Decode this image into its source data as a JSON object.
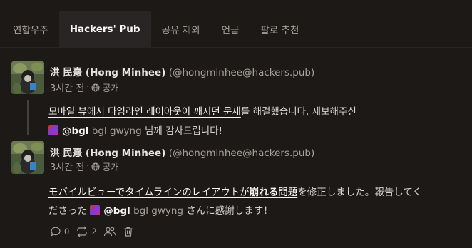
{
  "tabs": [
    {
      "label": "연합우주",
      "active": false
    },
    {
      "label": "Hackers' Pub",
      "active": true
    },
    {
      "label": "공유 제외",
      "active": false
    },
    {
      "label": "언급",
      "active": false
    },
    {
      "label": "팔로 추천",
      "active": false
    }
  ],
  "posts": [
    {
      "author_name": "洪 民憙 (Hong Minhee)",
      "author_handle": "(@hongminhee@hackers.pub)",
      "time": "3시간 전",
      "separator": "·",
      "visibility": "공개",
      "content": {
        "link": "모바일 뷰에서 타임라인 레이아웃이 깨지던 문제",
        "rest": "를 해결했습니다. 제보해주신",
        "mention_bold": "@bgl",
        "mention_name": "bgl gwyng",
        "ending": "님께 감사드립니다!"
      }
    },
    {
      "author_name": "洪 民憙 (Hong Minhee)",
      "author_handle": "(@hongminhee@hackers.pub)",
      "time": "3시간 전",
      "separator": "·",
      "visibility": "공개",
      "content": {
        "link_a": "モバイルビューでタイムラインのレイアウトが",
        "link_bold": "崩れる",
        "link_b": "問題",
        "rest": "を修正しました。報告してく",
        "line2_start": "ださった",
        "mention_bold": "@bgl",
        "mention_name": "bgl gwyng",
        "ending": "さんに感謝します！"
      },
      "actions": {
        "reply_count": "0",
        "share_count": "2"
      }
    }
  ],
  "colors": {
    "background": "#1c1917",
    "active_tab": "#292524",
    "muted": "#a8a29e"
  }
}
